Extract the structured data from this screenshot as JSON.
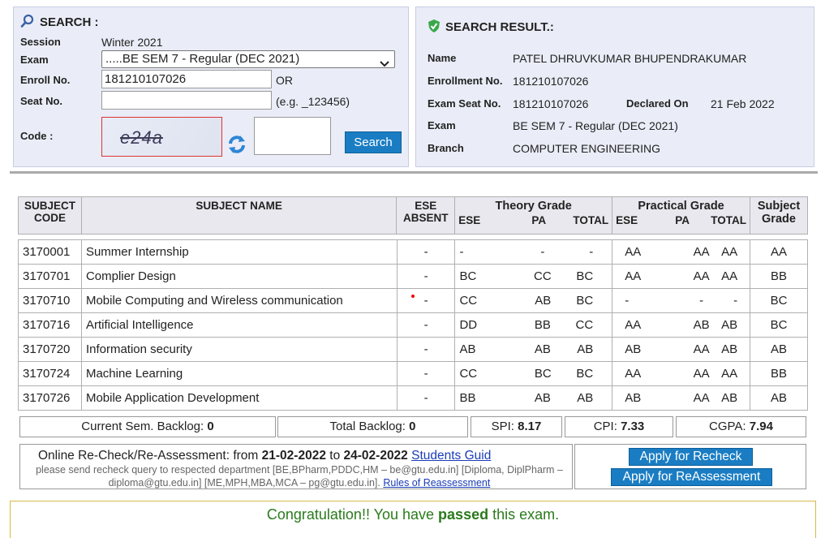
{
  "search": {
    "title": "SEARCH :",
    "session_label": "Session",
    "session_value": "Winter 2021",
    "exam_label": "Exam",
    "exam_value": ".....BE SEM 7 - Regular (DEC 2021)",
    "enroll_label": "Enroll No.",
    "enroll_value": "181210107026",
    "or_text": "OR",
    "seat_label": "Seat No.",
    "seat_value": "",
    "seat_hint": "(e.g. _123456)",
    "code_label": "Code :",
    "captcha_text": "e24a",
    "code_value": "",
    "search_button": "Search"
  },
  "result": {
    "title": "SEARCH RESULT.:",
    "name_label": "Name",
    "name_value": "PATEL DHRUVKUMAR BHUPENDRAKUMAR",
    "enroll_label": "Enrollment No.",
    "enroll_value": "181210107026",
    "seat_label": "Exam Seat No.",
    "seat_value": "181210107026",
    "declared_label": "Declared On",
    "declared_value": "21 Feb 2022",
    "exam_label": "Exam",
    "exam_value": "BE SEM 7 - Regular (DEC 2021)",
    "branch_label": "Branch",
    "branch_value": "COMPUTER ENGINEERING"
  },
  "grades_header": {
    "subject_code": "SUBJECT CODE",
    "subject_name": "SUBJECT NAME",
    "ese_absent": "ESE ABSENT",
    "theory": "Theory Grade",
    "practical": "Practical Grade",
    "subject_grade": "Subject Grade",
    "ese": "ESE",
    "pa": "PA",
    "total": "TOTAL"
  },
  "subjects": [
    {
      "code": "3170001",
      "name": "Summer Internship",
      "absent": "-",
      "t_ese": "-",
      "t_pa": "-",
      "t_total": "-",
      "p_ese": "AA",
      "p_pa": "AA",
      "p_total": "AA",
      "grade": "AA"
    },
    {
      "code": "3170701",
      "name": "Complier Design",
      "absent": "-",
      "t_ese": "BC",
      "t_pa": "CC",
      "t_total": "BC",
      "p_ese": "AA",
      "p_pa": "AA",
      "p_total": "AA",
      "grade": "BB"
    },
    {
      "code": "3170710",
      "name": "Mobile Computing and Wireless communication",
      "absent": "-",
      "t_ese": "CC",
      "t_pa": "AB",
      "t_total": "BC",
      "p_ese": "-",
      "p_pa": "-",
      "p_total": "-",
      "grade": "BC"
    },
    {
      "code": "3170716",
      "name": "Artificial Intelligence",
      "absent": "-",
      "t_ese": "DD",
      "t_pa": "BB",
      "t_total": "CC",
      "p_ese": "AA",
      "p_pa": "AB",
      "p_total": "AB",
      "grade": "BC"
    },
    {
      "code": "3170720",
      "name": "Information security",
      "absent": "-",
      "t_ese": "AB",
      "t_pa": "AB",
      "t_total": "AB",
      "p_ese": "AB",
      "p_pa": "AA",
      "p_total": "AB",
      "grade": "AB"
    },
    {
      "code": "3170724",
      "name": "Machine Learning",
      "absent": "-",
      "t_ese": "CC",
      "t_pa": "BC",
      "t_total": "BC",
      "p_ese": "AA",
      "p_pa": "AA",
      "p_total": "AA",
      "grade": "BB"
    },
    {
      "code": "3170726",
      "name": "Mobile Application Development",
      "absent": "-",
      "t_ese": "BB",
      "t_pa": "AB",
      "t_total": "AB",
      "p_ese": "AB",
      "p_pa": "AA",
      "p_total": "AB",
      "grade": "AB"
    }
  ],
  "summary": {
    "current_backlog_label": "Current Sem. Backlog:",
    "current_backlog": "0",
    "total_backlog_label": "Total Backlog:",
    "total_backlog": "0",
    "spi_label": "SPI:",
    "spi": "8.17",
    "cpi_label": "CPI:",
    "cpi": "7.33",
    "cgpa_label": "CGPA:",
    "cgpa": "7.94"
  },
  "recheck": {
    "prefix": "Online Re-Check/Re-Assessment: from",
    "from_date": "21-02-2022",
    "to_word": "to",
    "to_date": "24-02-2022",
    "guide_link": "Students Guid",
    "note": "please send recheck query to respected department [BE,BPharm,PDDC,HM – be@gtu.edu.in] [Diploma, DiplPharm – diploma@gtu.edu.in] [ME,MPH,MBA,MCA – pg@gtu.edu.in].",
    "rules_link": "Rules of Reassessment",
    "apply_recheck": "Apply for Recheck",
    "apply_reassessment": "Apply for ReAssessment"
  },
  "message": {
    "prefix": "Congratulation!! You have",
    "bold": "passed",
    "suffix": "this exam."
  },
  "colors": {
    "accent": "#1a7dc3",
    "panel": "#eaedf7",
    "success": "#2a7a1c"
  }
}
